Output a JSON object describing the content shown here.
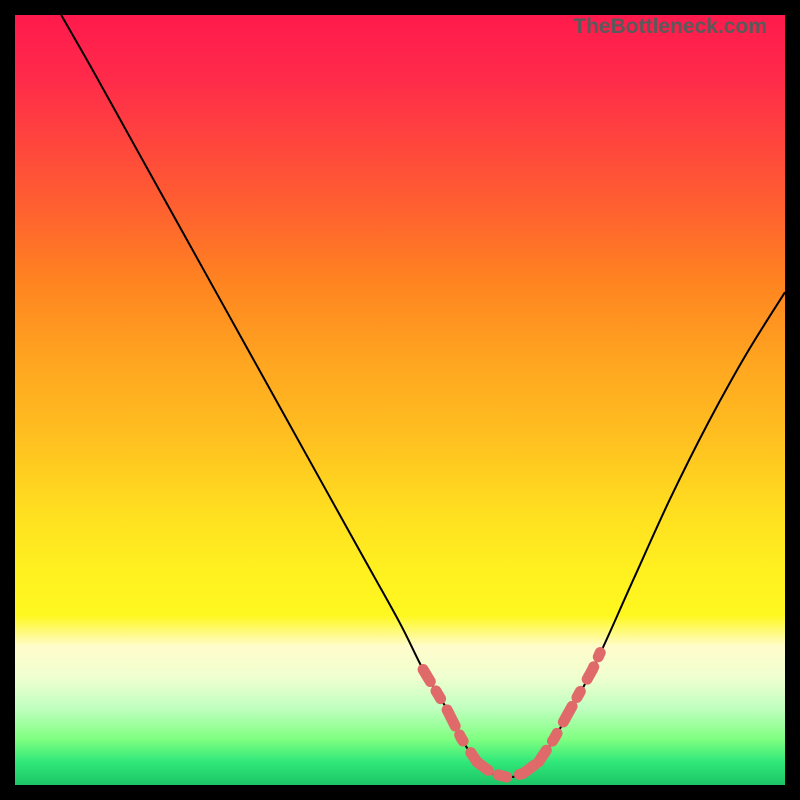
{
  "watermark": "TheBottleneck.com",
  "chart_data": {
    "type": "line",
    "title": "",
    "xlabel": "",
    "ylabel": "",
    "xlim": [
      0,
      100
    ],
    "ylim": [
      0,
      100
    ],
    "series": [
      {
        "name": "curve",
        "x": [
          6,
          10,
          15,
          20,
          25,
          30,
          35,
          40,
          45,
          50,
          53,
          56,
          58,
          60,
          62,
          64,
          66,
          68,
          70,
          75,
          80,
          85,
          90,
          95,
          100
        ],
        "y": [
          100,
          93,
          84,
          75,
          66,
          57,
          48,
          39,
          30,
          21,
          15,
          10,
          6,
          3,
          1.5,
          1,
          1.5,
          3,
          6,
          15,
          26,
          37,
          47,
          56,
          64
        ]
      }
    ],
    "highlight_segments": [
      {
        "x_range": [
          53,
          60
        ],
        "side": "left"
      },
      {
        "x_range": [
          60,
          68
        ],
        "side": "bottom"
      },
      {
        "x_range": [
          68,
          76
        ],
        "side": "right"
      }
    ],
    "highlight_color": "#e06a6a",
    "curve_color": "#000000",
    "background_gradient": [
      "#ff1a4d",
      "#ffa520",
      "#fff020",
      "#1cc466"
    ]
  }
}
